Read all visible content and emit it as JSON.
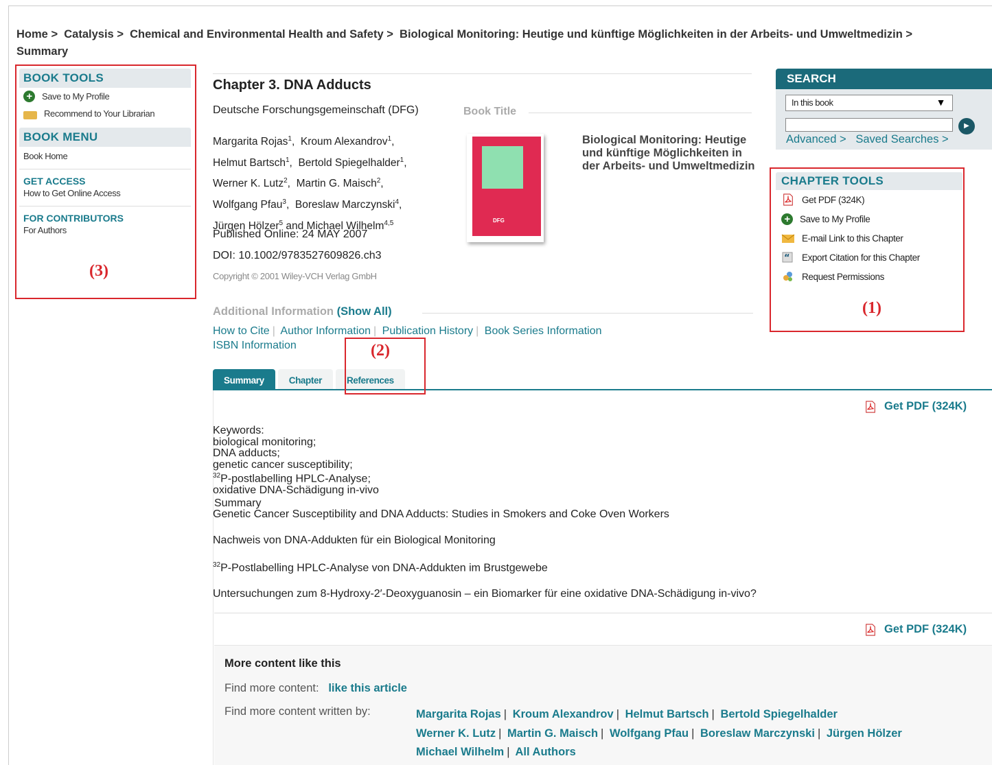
{
  "breadcrumb": {
    "items": [
      "Home",
      "Catalysis",
      "Chemical and Environmental Health and Safety",
      "Biological Monitoring: Heutige und künftige Möglichkeiten in der Arbeits- und Umweltmedizin",
      "Summary"
    ],
    "separator": ">"
  },
  "left_sidebar": {
    "book_tools_title": "BOOK TOOLS",
    "save_profile": "Save to My Profile",
    "recommend": "Recommend to Your Librarian",
    "book_menu_title": "BOOK MENU",
    "book_home": "Book Home",
    "get_access_title": "GET ACCESS",
    "get_access_text": "How to Get Online Access",
    "contributors_title": "FOR CONTRIBUTORS",
    "contributors_text": "For Authors",
    "annotation": "(3)"
  },
  "chapter": {
    "title": "Chapter 3. DNA Adducts",
    "org": "Deutsche Forschungsgemeinschaft (DFG)",
    "book_title_label": "Book Title",
    "book_name": "Biological Monitoring: Heutige und künftige Möglichkeiten in der Arbeits- und Umweltmedizin",
    "cover_mark": "DFG",
    "published": "Published Online: 24 MAY 2007",
    "doi": "DOI: 10.1002/9783527609826.ch3",
    "copyright": "Copyright © 2001 Wiley-VCH Verlag GmbH"
  },
  "authors": [
    {
      "name": "Margarita Rojas",
      "sup": "1"
    },
    {
      "name": "Kroum Alexandrov",
      "sup": "1"
    },
    {
      "name": "Helmut Bartsch",
      "sup": "1"
    },
    {
      "name": "Bertold Spiegelhalder",
      "sup": "1"
    },
    {
      "name": "Werner K. Lutz",
      "sup": "2"
    },
    {
      "name": "Martin G. Maisch",
      "sup": "2"
    },
    {
      "name": "Wolfgang Pfau",
      "sup": "3"
    },
    {
      "name": "Boreslaw Marczynski",
      "sup": "4"
    },
    {
      "name": "Jürgen Hölzer",
      "sup": "5"
    },
    {
      "name": "Michael Wilhelm",
      "sup": "4,5"
    }
  ],
  "additional": {
    "label": "Additional Information",
    "show_all": "(Show All)",
    "links": [
      "How to Cite",
      "Author Information",
      "Publication History",
      "Book Series Information",
      "ISBN Information"
    ]
  },
  "tabs": [
    "Summary",
    "Chapter",
    "References"
  ],
  "annotation_tabs": "(2)",
  "get_pdf": "Get PDF (324K)",
  "keywords": {
    "label": "Keywords:",
    "items": [
      "biological monitoring;",
      "DNA adducts;",
      "genetic cancer susceptibility;",
      "P-postlabelling HPLC-Analyse;",
      "oxidative DNA-Schädigung in-vivo"
    ],
    "sup_prefix": "32"
  },
  "summary": {
    "label": "Summary",
    "lines": [
      "Genetic Cancer Susceptibility and DNA Adducts: Studies in Smokers and Coke Oven Workers",
      "Nachweis von DNA-Addukten für ein Biological Monitoring",
      "P-Postlabelling HPLC-Analyse von DNA-Addukten im Brustgewebe",
      "Untersuchungen zum 8-Hydroxy-2′-Deoxyguanosin – ein Biomarker für eine oxidative DNA-Schädigung in-vivo?"
    ],
    "sup_prefix": "32"
  },
  "more": {
    "title": "More content like this",
    "find_content_label": "Find more content:",
    "find_content_link": "like this article",
    "written_by_label": "Find more content written by:",
    "authors": [
      "Margarita Rojas",
      "Kroum Alexandrov",
      "Helmut Bartsch",
      "Bertold Spiegelhalder",
      "Werner K. Lutz",
      "Martin G. Maisch",
      "Wolfgang Pfau",
      "Boreslaw Marczynski",
      "Jürgen Hölzer",
      "Michael Wilhelm",
      "All Authors"
    ]
  },
  "search": {
    "title": "SEARCH",
    "scope": "In this book",
    "advanced": "Advanced >",
    "saved": "Saved Searches >"
  },
  "chapter_tools": {
    "title": "CHAPTER TOOLS",
    "items": [
      "Get PDF (324K)",
      "Save to My Profile",
      "E-mail Link to this Chapter",
      "Export Citation for this Chapter",
      "Request Permissions"
    ],
    "annotation": "(1)"
  },
  "colors": {
    "accent": "#1a7b8c",
    "annotation": "#d9262c",
    "search_header": "#1b6a7a"
  }
}
